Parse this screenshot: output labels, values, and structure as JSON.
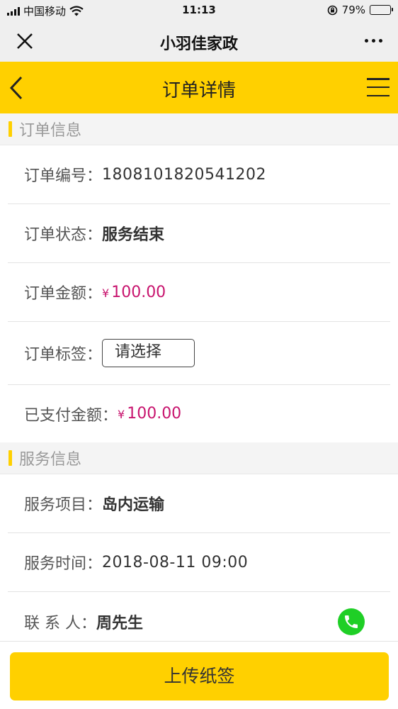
{
  "status_bar": {
    "carrier": "中国移动",
    "time": "11:13",
    "battery": "79%",
    "battery_level": 0.79
  },
  "wechat_bar": {
    "title": "小羽佳家政",
    "close_icon": "close-icon",
    "more_icon": "more-icon"
  },
  "app_header": {
    "title": "订单详情",
    "back_icon": "chevron-left-icon",
    "menu_icon": "hamburger-menu-icon"
  },
  "order_section": {
    "title": "订单信息",
    "rows": [
      {
        "label": "订单编号：",
        "value": "1808101820541202"
      },
      {
        "label": "订单状态：",
        "value": "服务结束"
      },
      {
        "label": "订单金额：",
        "currency": "¥",
        "value": "100.00"
      },
      {
        "label": "订单标签：",
        "select_placeholder": "请选择"
      },
      {
        "label": "已支付金额：",
        "currency": "¥",
        "value": "100.00"
      }
    ]
  },
  "service_section": {
    "title": "服务信息",
    "rows": [
      {
        "label": "服务项目：",
        "value": "岛内运输"
      },
      {
        "label": "服务时间：",
        "value": "2018-08-11 09:00"
      },
      {
        "label": "联 系 人：",
        "value": "周先生"
      }
    ]
  },
  "bottom": {
    "upload_label": "上传纸签"
  },
  "colors": {
    "accent": "#ffd000",
    "money": "#c8146e",
    "phone": "#1fcf26"
  }
}
